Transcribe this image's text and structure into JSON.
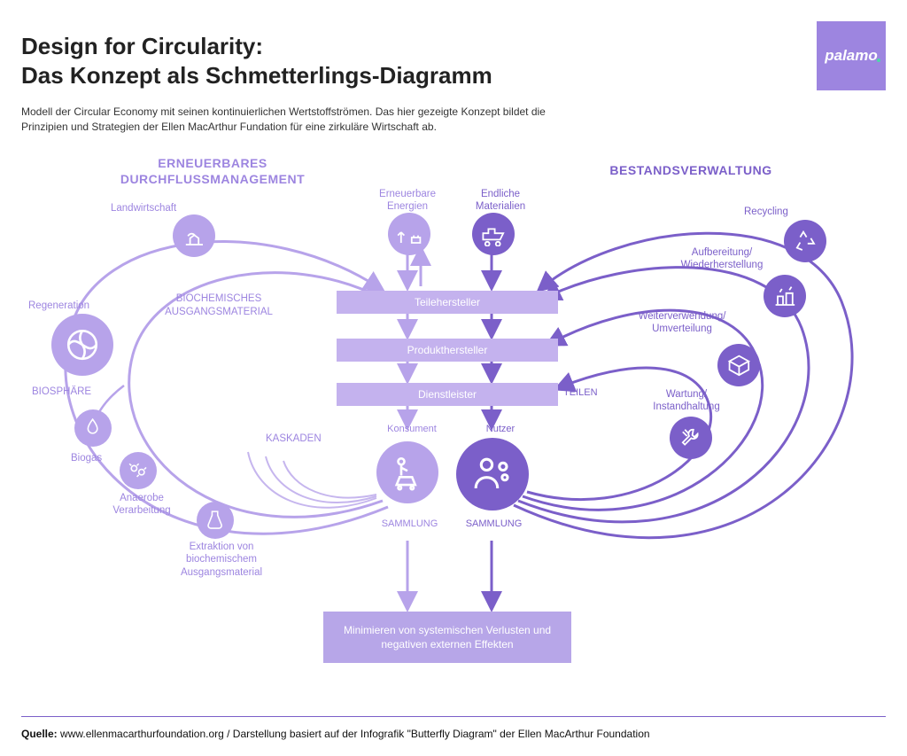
{
  "brand": "palamo",
  "title_line1": "Design  for Circularity:",
  "title_line2": "Das Konzept als Schmetterlings-Diagramm",
  "subtitle": "Modell der Circular Economy mit seinen kontinuierlichen Wertstoffströmen. Das hier gezeigte Konzept bildet die Prinzipien und Strategien der Ellen MacArthur  Fundation für eine zirkuläre Wirtschaft ab.",
  "sections": {
    "left": "ERNEUERBARES DURCHFLUSSMANAGEMENT",
    "right": "BESTANDSVERWALTUNG"
  },
  "top_inputs": {
    "renewable": "Erneuerbare Energien",
    "finite": "Endliche Materialien"
  },
  "center_stages": {
    "parts": "Teilehersteller",
    "product": "Produkthersteller",
    "service": "Dienstleister"
  },
  "center_actors": {
    "consumer": "Konsument",
    "user": "Nutzer",
    "share": "TEILEN",
    "collection": "SAMMLUNG"
  },
  "left_nodes": {
    "agriculture": "Landwirtschaft",
    "regeneration": "Regeneration",
    "biosphere": "BIOSPHÄRE",
    "biogas": "Biogas",
    "anaerobic": "Anaerobe Verarbeitung",
    "extraction": "Extraktion von biochemischem Ausgangsmaterial",
    "biochem_feedstock": "BIOCHEMISCHES AUSGANGSMATERIAL",
    "cascades": "KASKADEN"
  },
  "right_nodes": {
    "recycling": "Recycling",
    "refurbish": "Aufbereitung/ Wiederherstellung",
    "redistribute": "Weiterverwendung/ Umverteilung",
    "maintain": "Wartung/ Instandhaltung"
  },
  "bottom_box": "Minimieren von  systemischen Verlusten und negativen externen Effekten",
  "footer": {
    "label": "Quelle:",
    "text": " www.ellenmacarthurfoundation.org / Darstellung basiert auf der Infografik \"Butterfly Diagram\" der Ellen MacArthur Foundation"
  },
  "colors": {
    "light": "#b7a3ea",
    "dark": "#7b5fc9",
    "accent_text": "#9d85e0"
  }
}
